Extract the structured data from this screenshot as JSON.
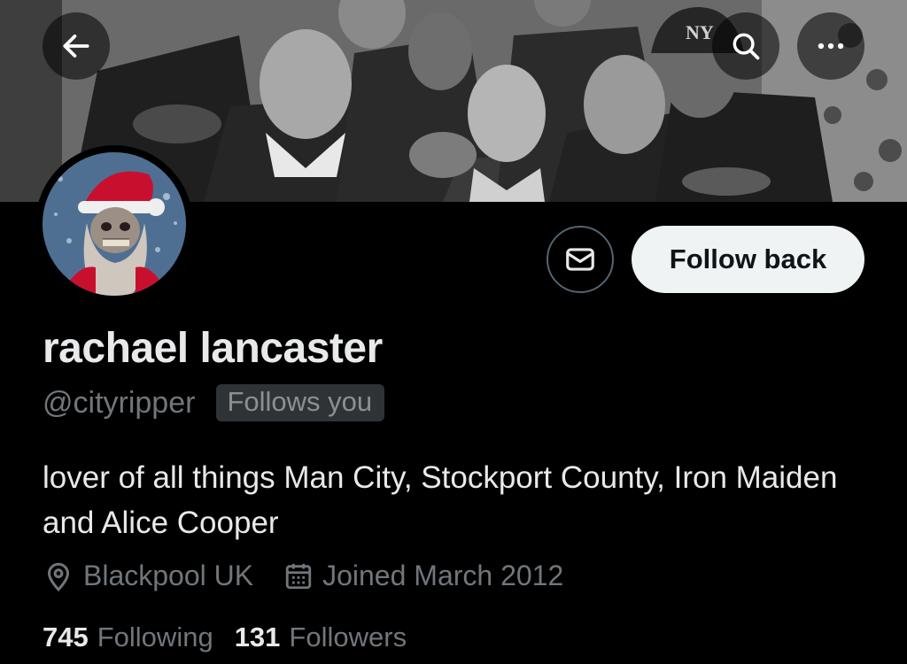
{
  "profile": {
    "display_name": "rachael lancaster",
    "handle": "@cityripper",
    "follows_you": "Follows you",
    "bio": "lover of all things Man City, Stockport County, Iron Maiden and Alice Cooper",
    "location": "Blackpool UK",
    "joined": "Joined March 2012"
  },
  "actions": {
    "follow_back": "Follow back"
  },
  "stats": {
    "following_count": "745",
    "following_label": "Following",
    "followers_count": "131",
    "followers_label": "Followers"
  },
  "icons": {
    "back": "arrow-left-icon",
    "search": "search-icon",
    "more": "more-dots-icon",
    "message": "envelope-icon",
    "location": "location-pin-icon",
    "calendar": "calendar-icon"
  },
  "banner": {
    "cap_logo": "NY"
  },
  "colors": {
    "background": "#000000",
    "primary_text": "#e7e9ea",
    "secondary_text": "#71767b",
    "button_light": "#eff3f4",
    "badge_bg": "#2f3336",
    "santa_red": "#c8102e"
  }
}
